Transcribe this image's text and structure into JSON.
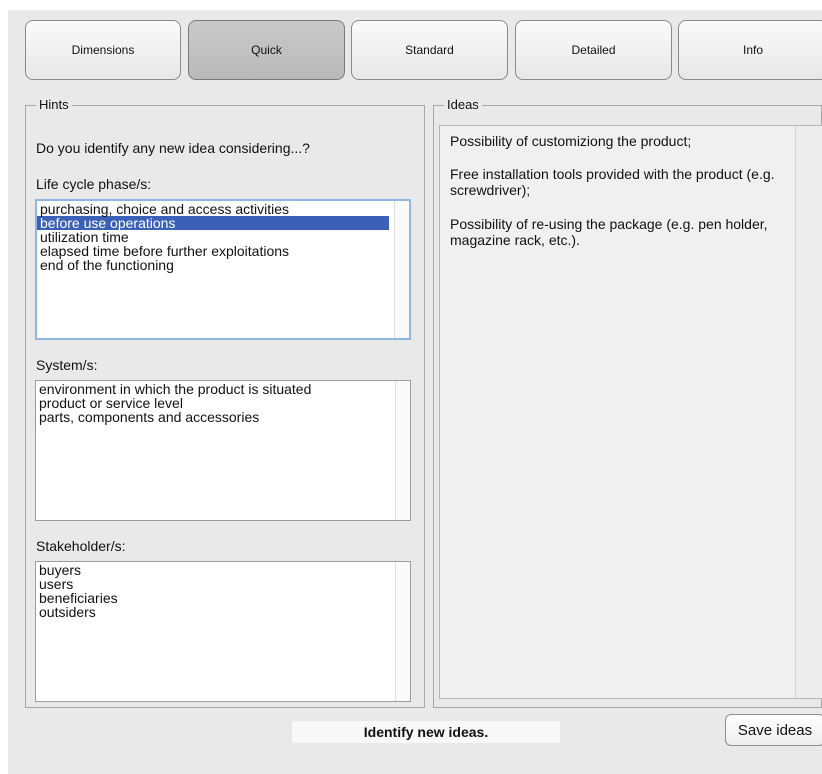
{
  "tabs": [
    {
      "label": "Dimensions"
    },
    {
      "label": "Quick"
    },
    {
      "label": "Standard"
    },
    {
      "label": "Detailed"
    },
    {
      "label": "Info"
    }
  ],
  "active_tab": "Quick",
  "hints": {
    "title": "Hints",
    "question": "Do you identify any new idea considering...?",
    "life_cycle_label": "Life cycle phase/s:",
    "life_cycle_items": [
      "purchasing, choice and access activities",
      "before use operations",
      "utilization time",
      "elapsed time before further exploitations",
      "end of the functioning"
    ],
    "life_cycle_selected": "before use operations",
    "system_label": "System/s:",
    "system_items": [
      "environment in which the product is situated",
      "product or service level",
      "parts, components and accessories"
    ],
    "stakeholder_label": "Stakeholder/s:",
    "stakeholder_items": [
      "buyers",
      "users",
      "beneficiaries",
      "outsiders"
    ]
  },
  "ideas": {
    "title": "Ideas",
    "paragraphs": [
      "Possibility of customiziong the product;",
      "Free installation tools provided with the product (e.g. screwdriver);",
      "Possibility of re-using the package (e.g. pen holder, magazine rack, etc.)."
    ]
  },
  "status_text": "Identify new ideas.",
  "save_button_label": "Save ideas",
  "colors": {
    "selection": "#3b60b8",
    "focus_border": "#8fb6de",
    "window_bg": "#e9e9e9"
  }
}
